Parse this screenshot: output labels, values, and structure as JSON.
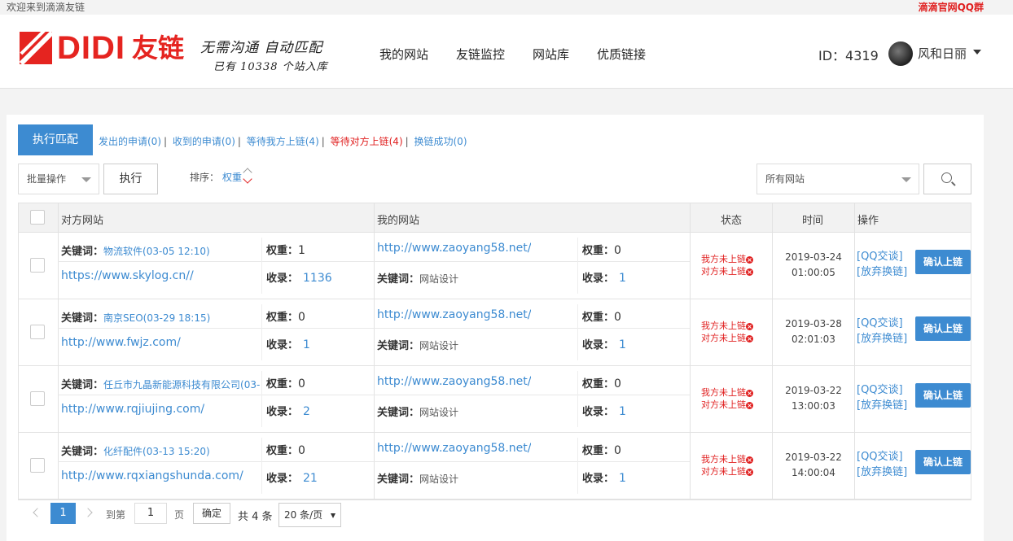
{
  "topbar": {
    "welcome": "欢迎来到滴滴友链",
    "qq_group": "滴滴官网QQ群"
  },
  "header": {
    "logo_text": "DIDI",
    "logo_cn": "友链",
    "slogan_line1": "无需沟通 自动匹配",
    "slogan_line2": "已有 10338 个站入库",
    "nav": [
      "我的网站",
      "友链监控",
      "网站库",
      "优质链接"
    ],
    "user_id": "ID：4319",
    "username": "风和日丽"
  },
  "toolbar": {
    "match_button": "执行匹配",
    "filters": [
      {
        "label": "发出的申请(0)",
        "color": "blue"
      },
      {
        "label": "收到的申请(0)",
        "color": "blue"
      },
      {
        "label": "等待我方上链(4)",
        "color": "blue"
      },
      {
        "label": "等待对方上链(4)",
        "color": "red"
      },
      {
        "label": "换链成功(0)",
        "color": "blue"
      }
    ],
    "batch_select": "批量操作",
    "exec_button": "执行",
    "sort_label": "排序：",
    "sort_value": "权重",
    "site_select": "所有网站"
  },
  "table": {
    "headers": {
      "their_site": "对方网站",
      "my_site": "我的网站",
      "status": "状态",
      "time": "时间",
      "ops": "操作"
    },
    "labels": {
      "keyword": "关键词：",
      "weight": "权重：",
      "indexed": "收录："
    },
    "rows": [
      {
        "their_keyword": "物流软件(03-05 12:10)",
        "their_weight": "1",
        "their_url": "https://www.skylog.cn//",
        "their_indexed": "1136",
        "my_url": "http://www.zaoyang58.net/",
        "my_weight": "0",
        "my_keyword": "网站设计",
        "my_indexed": "1",
        "status1": "我方未上链",
        "status2": "对方未上链",
        "date": "2019-03-24",
        "time": "01:00:05",
        "op_qq": "[QQ交谈]",
        "op_abandon": "[放弃换链]",
        "confirm": "确认上链"
      },
      {
        "their_keyword": "南京SEO(03-29 18:15)",
        "their_weight": "0",
        "their_url": "http://www.fwjz.com/",
        "their_indexed": "1",
        "my_url": "http://www.zaoyang58.net/",
        "my_weight": "0",
        "my_keyword": "网站设计",
        "my_indexed": "1",
        "status1": "我方未上链",
        "status2": "对方未上链",
        "date": "2019-03-28",
        "time": "02:01:03",
        "op_qq": "[QQ交谈]",
        "op_abandon": "[放弃换链]",
        "confirm": "确认上链"
      },
      {
        "their_keyword": "任丘市九晶新能源科技有限公司(03-",
        "their_weight": "0",
        "their_url": "http://www.rqjiujing.com/",
        "their_indexed": "2",
        "my_url": "http://www.zaoyang58.net/",
        "my_weight": "0",
        "my_keyword": "网站设计",
        "my_indexed": "1",
        "status1": "我方未上链",
        "status2": "对方未上链",
        "date": "2019-03-22",
        "time": "13:00:03",
        "op_qq": "[QQ交谈]",
        "op_abandon": "[放弃换链]",
        "confirm": "确认上链"
      },
      {
        "their_keyword": "化纤配件(03-13 15:20)",
        "their_weight": "0",
        "their_url": "http://www.rqxiangshunda.com/",
        "their_indexed": "21",
        "my_url": "http://www.zaoyang58.net/",
        "my_weight": "0",
        "my_keyword": "网站设计",
        "my_indexed": "1",
        "status1": "我方未上链",
        "status2": "对方未上链",
        "date": "2019-03-22",
        "time": "14:00:04",
        "op_qq": "[QQ交谈]",
        "op_abandon": "[放弃换链]",
        "confirm": "确认上链"
      }
    ]
  },
  "pager": {
    "current": "1",
    "goto_label": "到第",
    "goto_value": "1",
    "page_label": "页",
    "ok_button": "确定",
    "total": "共 4 条",
    "page_size": "20 条/页"
  },
  "colors": {
    "accent": "#3d8bd1",
    "brand": "#e52420",
    "alert": "#e02020"
  }
}
